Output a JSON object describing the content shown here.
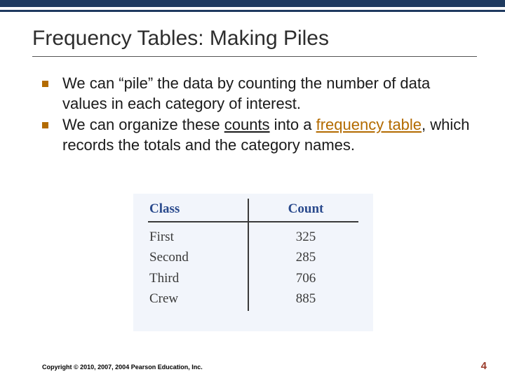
{
  "title": "Frequency Tables: Making Piles",
  "bullets": [
    {
      "pre": "We can “pile” the data by counting the number of data values in each category of interest."
    },
    {
      "pre": "We can organize these ",
      "u1": "counts",
      "mid": " into a ",
      "kw": "frequency table",
      "post": ", which records the totals and the category names."
    }
  ],
  "chart_data": {
    "type": "table",
    "headers": [
      "Class",
      "Count"
    ],
    "rows": [
      {
        "label": "First",
        "value": 325
      },
      {
        "label": "Second",
        "value": 285
      },
      {
        "label": "Third",
        "value": 706
      },
      {
        "label": "Crew",
        "value": 885
      }
    ]
  },
  "footer": "Copyright © 2010, 2007, 2004 Pearson Education, Inc.",
  "page_number": "4"
}
